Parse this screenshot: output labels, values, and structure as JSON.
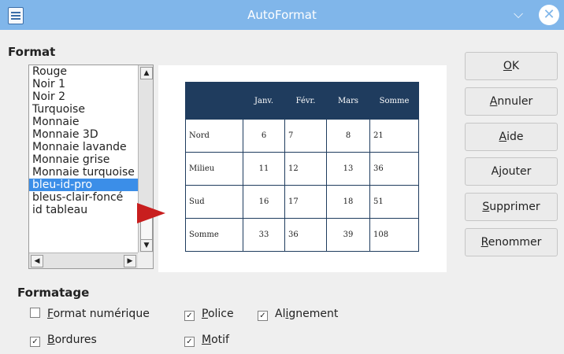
{
  "window": {
    "title": "AutoFormat",
    "minimize_glyph": "⌵",
    "close_glyph": "✕"
  },
  "format": {
    "label": "Format",
    "items": [
      "Rouge",
      "Noir 1",
      "Noir 2",
      "Turquoise",
      "Monnaie",
      "Monnaie 3D",
      "Monnaie lavande",
      "Monnaie grise",
      "Monnaie turquoise",
      "bleu-id-pro",
      "bleus-clair-foncé",
      "id tableau"
    ],
    "selected": "bleu-id-pro"
  },
  "preview_table": {
    "headers": [
      "",
      "Janv.",
      "Févr.",
      "Mars",
      "Somme"
    ],
    "rows": [
      [
        "Nord",
        "6",
        "7",
        "8",
        "21"
      ],
      [
        "Milieu",
        "11",
        "12",
        "13",
        "36"
      ],
      [
        "Sud",
        "16",
        "17",
        "18",
        "51"
      ],
      [
        "Somme",
        "33",
        "36",
        "39",
        "108"
      ]
    ]
  },
  "buttons": {
    "ok": {
      "first": "O",
      "rest": "K"
    },
    "cancel": {
      "first": "A",
      "rest": "nnuler"
    },
    "help": {
      "pre": "",
      "key": "A",
      "rest": "ide"
    },
    "add": {
      "pre": "A",
      "key": "j",
      "rest": "outer"
    },
    "delete": {
      "first": "S",
      "rest": "upprimer"
    },
    "rename": {
      "first": "R",
      "rest": "enommer"
    }
  },
  "formatage": {
    "label": "Formatage",
    "number_format": {
      "key": "F",
      "rest": "ormat numérique",
      "checked": false
    },
    "font": {
      "key": "P",
      "rest": "olice",
      "checked": true
    },
    "alignment": {
      "pre": "Al",
      "key": "i",
      "rest": "gnement",
      "checked": true
    },
    "borders": {
      "key": "B",
      "rest": "ordures",
      "checked": true
    },
    "pattern": {
      "key": "M",
      "rest": "otif",
      "checked": true
    }
  },
  "colors": {
    "titlebar": "#80b6ea",
    "selection": "#3b8ee8",
    "table_header": "#1f3c5e",
    "arrow": "#c81e1e"
  },
  "icons": {
    "app": "document-icon",
    "minimize": "chevron-down-icon",
    "close": "close-icon",
    "pointer": "red-arrow-icon"
  }
}
